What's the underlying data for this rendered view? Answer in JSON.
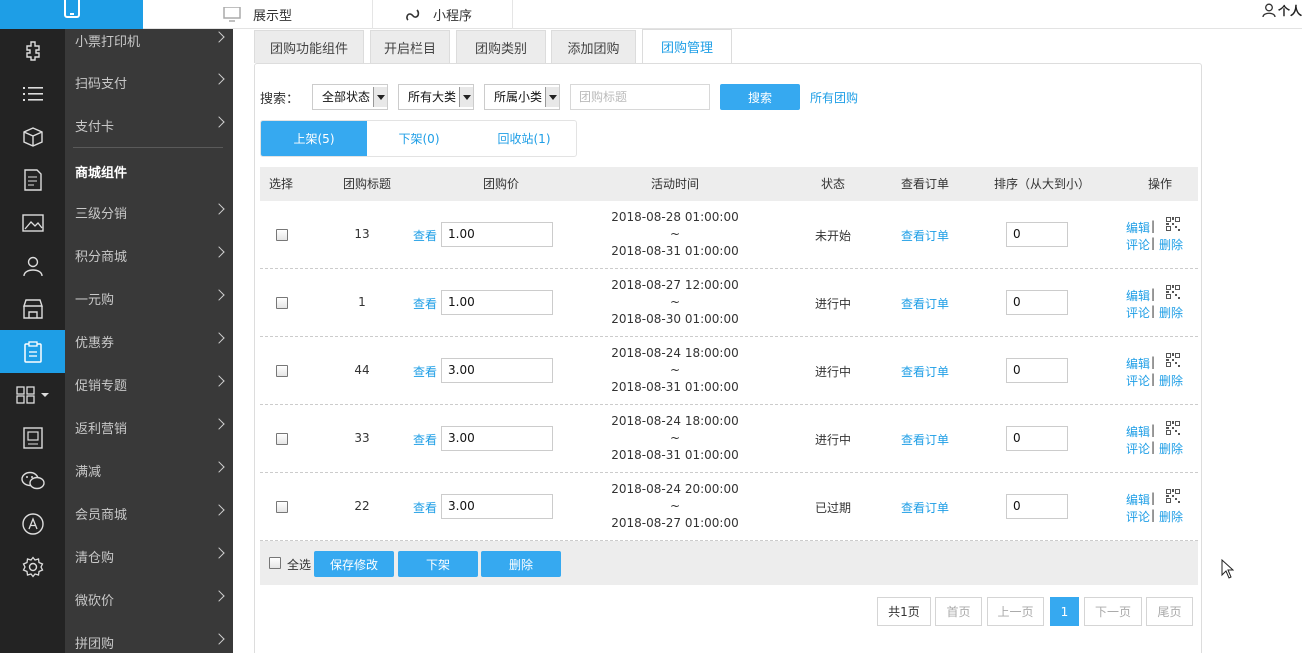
{
  "topbar": {
    "tab_display": "展示型",
    "tab_miniprogram": "小程序",
    "user_label": "个人"
  },
  "submenu": {
    "items": [
      {
        "label": "小票打印机"
      },
      {
        "label": "扫码支付"
      },
      {
        "label": "支付卡"
      },
      {
        "label": "三级分销"
      },
      {
        "label": "积分商城"
      },
      {
        "label": "一元购"
      },
      {
        "label": "优惠券"
      },
      {
        "label": "促销专题"
      },
      {
        "label": "返利营销"
      },
      {
        "label": "满减"
      },
      {
        "label": "会员商城"
      },
      {
        "label": "清仓购"
      },
      {
        "label": "微砍价"
      },
      {
        "label": "拼团购"
      }
    ],
    "section_header": "商城组件"
  },
  "tabs": [
    "团购功能组件",
    "开启栏目",
    "团购类别",
    "添加团购",
    "团购管理"
  ],
  "active_tab": "团购管理",
  "search": {
    "label": "搜索：",
    "status_select": "全部状态",
    "category_select": "所有大类",
    "subcategory_select": "所属小类",
    "title_placeholder": "团购标题",
    "search_button": "搜索",
    "all_link": "所有团购"
  },
  "segments": [
    "上架(5)",
    "下架(0)",
    "回收站(1)"
  ],
  "table": {
    "headers": [
      "选择",
      "团购标题",
      "团购价",
      "活动时间",
      "状态",
      "查看订单",
      "排序（从大到小）",
      "操作"
    ],
    "view_label": "查看",
    "view_orders_label": "查看订单",
    "edit_label": "编辑",
    "comment_label": "评论",
    "delete_label": "删除",
    "sep": "|",
    "tilde": "~",
    "rows": [
      {
        "title": "13",
        "price": "1.00",
        "start": "2018-08-28 01:00:00",
        "end": "2018-08-31 01:00:00",
        "status": "未开始",
        "sort": "0"
      },
      {
        "title": "1",
        "price": "1.00",
        "start": "2018-08-27 12:00:00",
        "end": "2018-08-30 01:00:00",
        "status": "进行中",
        "sort": "0"
      },
      {
        "title": "44",
        "price": "3.00",
        "start": "2018-08-24 18:00:00",
        "end": "2018-08-31 01:00:00",
        "status": "进行中",
        "sort": "0"
      },
      {
        "title": "33",
        "price": "3.00",
        "start": "2018-08-24 18:00:00",
        "end": "2018-08-31 01:00:00",
        "status": "进行中",
        "sort": "0"
      },
      {
        "title": "22",
        "price": "3.00",
        "start": "2018-08-24 20:00:00",
        "end": "2018-08-27 01:00:00",
        "status": "已过期",
        "sort": "0"
      }
    ]
  },
  "footer": {
    "select_all": "全选",
    "save": "保存修改",
    "unlist": "下架",
    "delete": "删除"
  },
  "pager": {
    "total": "共1页",
    "first": "首页",
    "prev": "上一页",
    "current": "1",
    "next": "下一页",
    "last": "尾页"
  },
  "colors": {
    "accent": "#1e9ee6",
    "button": "#36a9f0",
    "rail": "#232323",
    "submenu": "#393939"
  }
}
